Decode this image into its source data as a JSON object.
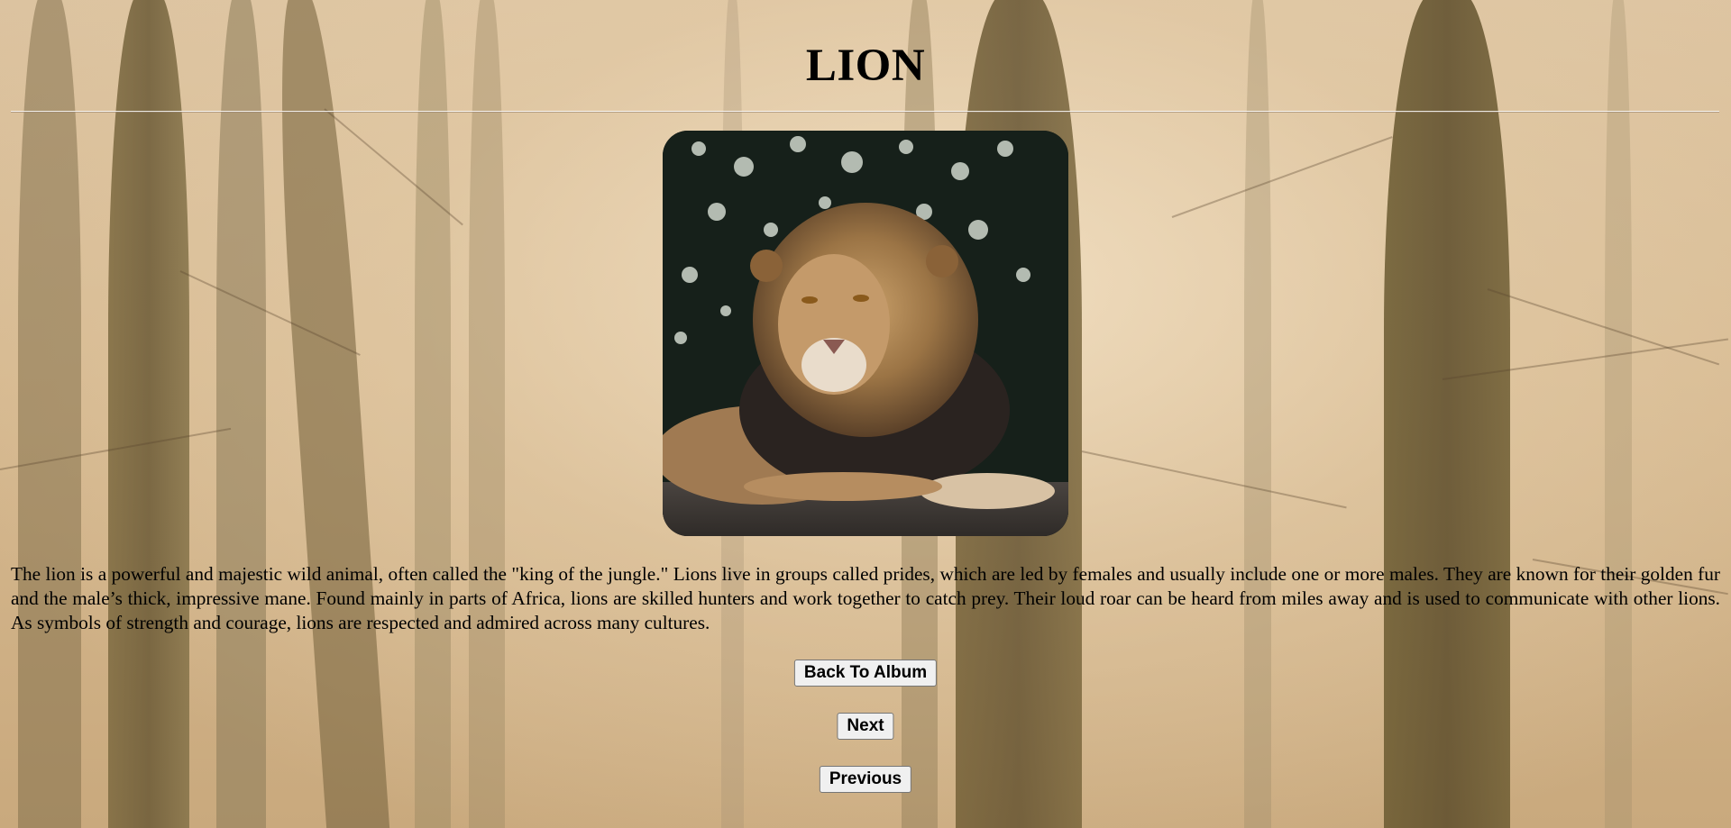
{
  "page": {
    "title": "LION",
    "description": "The lion is a powerful and majestic wild animal, often called the \"king of the jungle.\" Lions live in groups called prides, which are led by females and usually include one or more males. They are known for their golden fur and the male’s thick, impressive mane. Found mainly in parts of Africa, lions are skilled hunters and work together to catch prey. Their loud roar can be heard from miles away and is used to communicate with other lions. As symbols of strength and courage, lions are respected and admired across many cultures."
  },
  "buttons": {
    "back_label": "Back To Album",
    "next_label": "Next",
    "previous_label": "Previous"
  },
  "colors": {
    "background": "#cfb28c",
    "text": "#000000",
    "button_bg": "#f0f0f0"
  }
}
